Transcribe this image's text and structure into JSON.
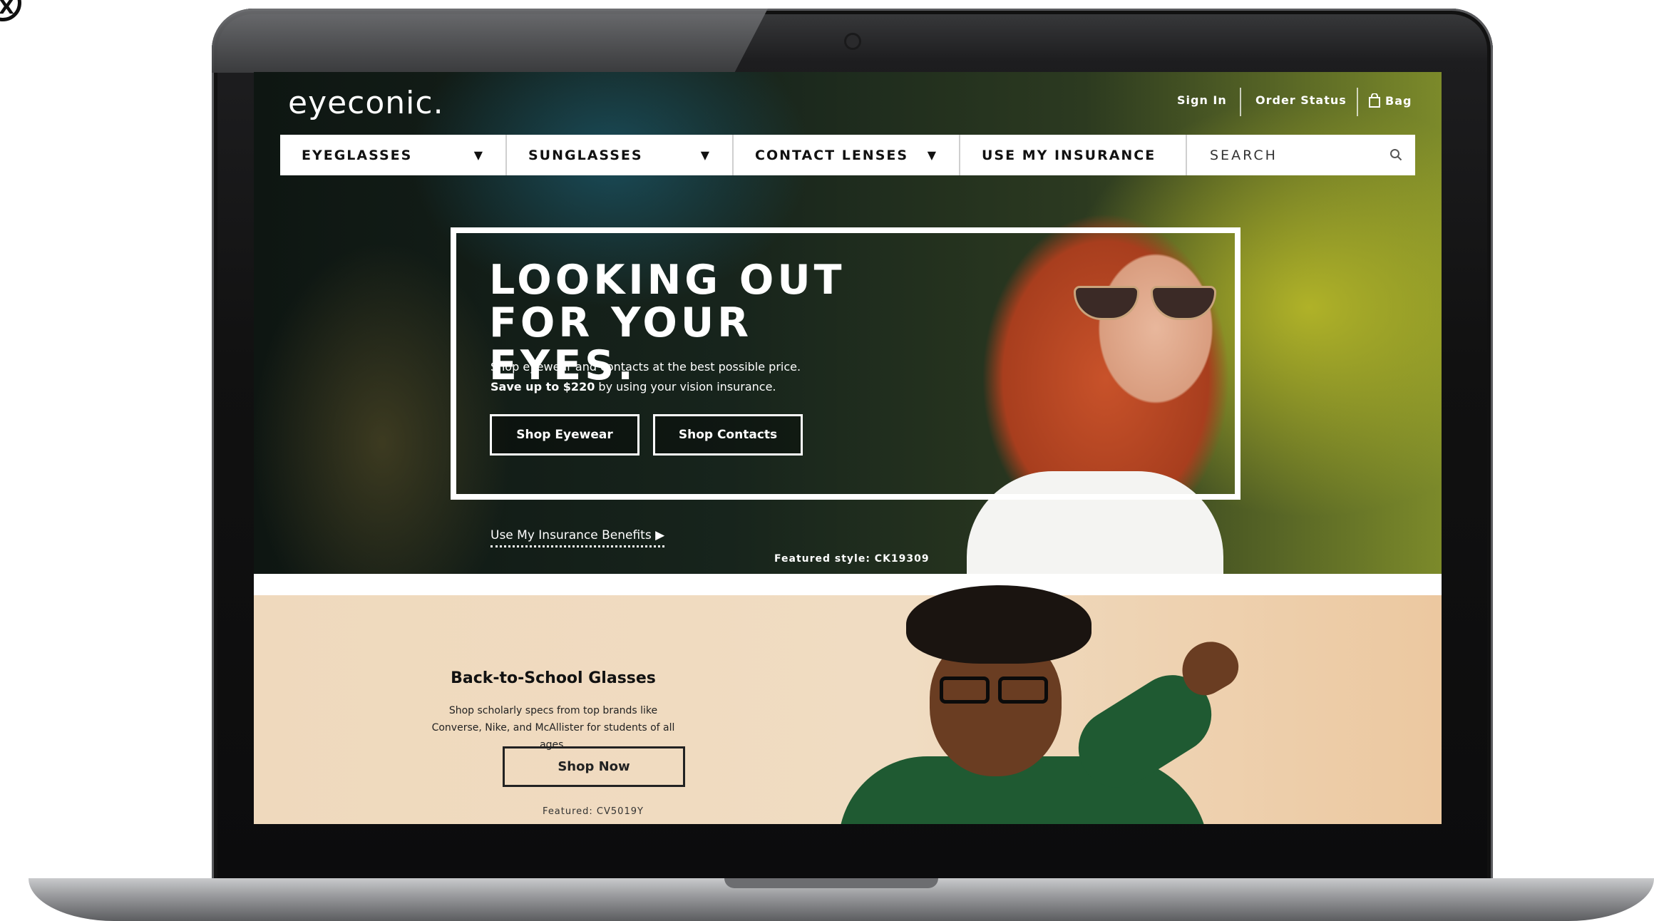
{
  "corner_badge": "X",
  "header": {
    "logo": "eyeconic.",
    "links": {
      "sign_in": "Sign In",
      "order_status": "Order Status",
      "bag": "Bag"
    }
  },
  "nav": {
    "items": [
      {
        "label": "EYEGLASSES",
        "caret": "▼"
      },
      {
        "label": "SUNGLASSES",
        "caret": "▼"
      },
      {
        "label": "CONTACT LENSES",
        "caret": "▼"
      },
      {
        "label": "USE MY INSURANCE"
      }
    ],
    "search_placeholder": "SEARCH"
  },
  "hero": {
    "headline": "LOOKING OUT FOR YOUR EYES.",
    "subline": "Shop eyewear and contacts at the best possible price.",
    "savings_bold": "Save up to $220",
    "savings_rest": " by using your vision insurance.",
    "buttons": {
      "eyewear": "Shop Eyewear",
      "contacts": "Shop Contacts"
    },
    "insurance_link": "Use My Insurance Benefits ▶",
    "featured": "Featured style: CK19309"
  },
  "promo": {
    "title": "Back-to-School Glasses",
    "body": "Shop scholarly specs from top brands like Converse, Nike, and McAllister for students of all ages.",
    "button": "Shop Now",
    "featured": "Featured: CV5019Y"
  },
  "colors": {
    "nav_bg": "#ffffff",
    "promo_bg": "#efd9bd",
    "text_dark": "#111111"
  }
}
